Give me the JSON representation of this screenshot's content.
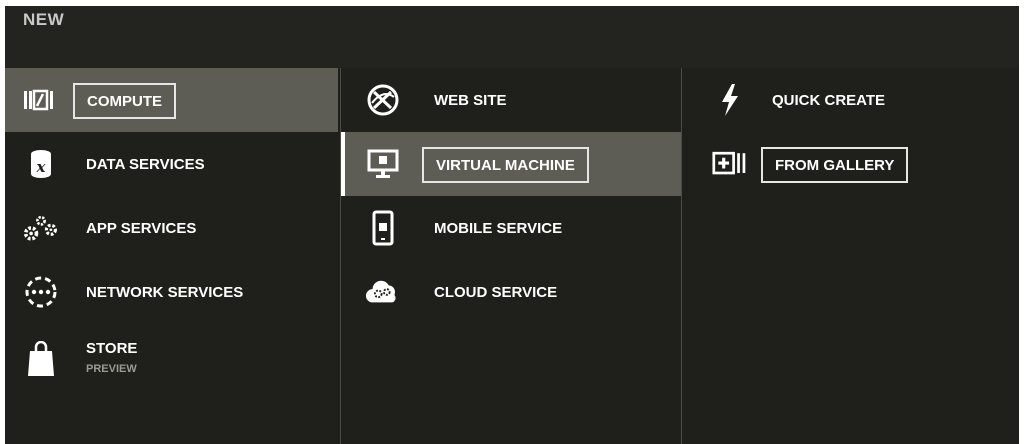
{
  "header": {
    "title": "NEW"
  },
  "categories": [
    {
      "label": "COMPUTE",
      "icon": "compute-icon"
    },
    {
      "label": "DATA SERVICES",
      "icon": "database-icon"
    },
    {
      "label": "APP SERVICES",
      "icon": "gears-icon"
    },
    {
      "label": "NETWORK SERVICES",
      "icon": "network-icon"
    },
    {
      "label": "STORE",
      "sublabel": "PREVIEW",
      "icon": "shopping-bag-icon"
    }
  ],
  "compute_items": [
    {
      "label": "WEB SITE",
      "icon": "globe-icon"
    },
    {
      "label": "VIRTUAL MACHINE",
      "icon": "monitor-icon"
    },
    {
      "label": "MOBILE SERVICE",
      "icon": "mobile-icon"
    },
    {
      "label": "CLOUD SERVICE",
      "icon": "cloud-icon"
    }
  ],
  "vm_options": [
    {
      "label": "QUICK CREATE",
      "icon": "lightning-icon"
    },
    {
      "label": "FROM GALLERY",
      "icon": "gallery-add-icon"
    }
  ],
  "colors": {
    "background": "#1f1f1b",
    "selected": "#5d5d55",
    "text": "#ffffff"
  }
}
